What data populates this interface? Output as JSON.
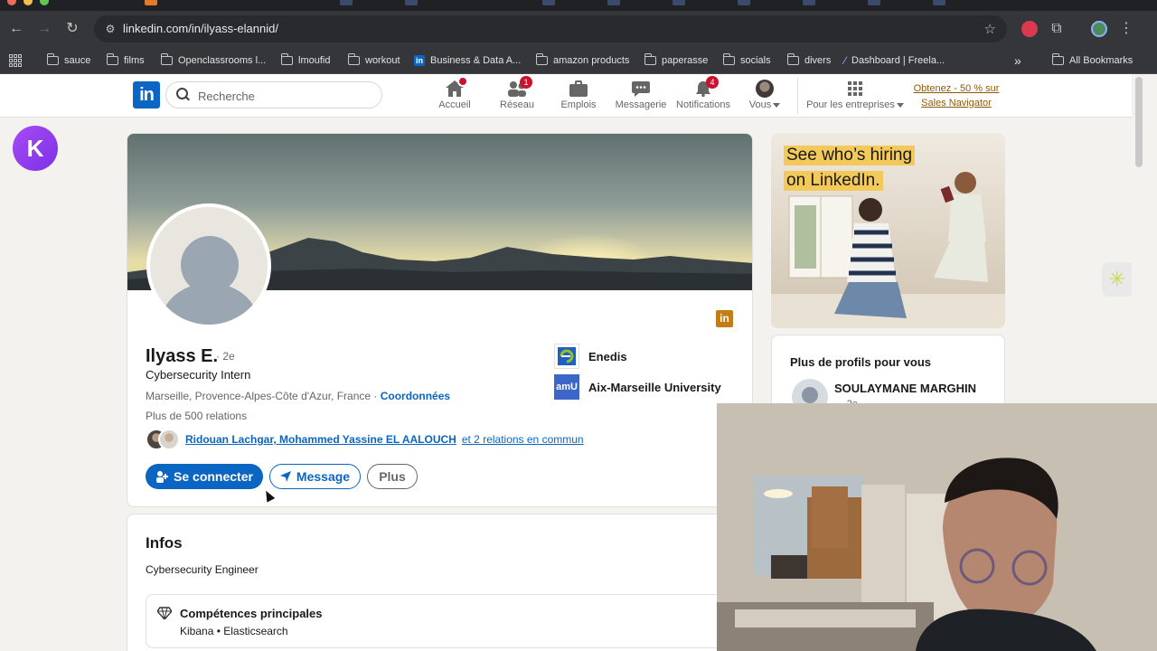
{
  "browser": {
    "url": "linkedin.com/in/ilyass-elannid/",
    "bookmarks": [
      {
        "label": "sauce",
        "icon": "folder-icon"
      },
      {
        "label": "films",
        "icon": "folder-icon"
      },
      {
        "label": "Openclassrooms l...",
        "icon": "folder-icon"
      },
      {
        "label": "lmoufid",
        "icon": "folder-icon"
      },
      {
        "label": "workout",
        "icon": "folder-icon"
      },
      {
        "label": "Business & Data A...",
        "icon": "linkedin-icon"
      },
      {
        "label": "amazon products",
        "icon": "folder-icon"
      },
      {
        "label": "paperasse",
        "icon": "folder-icon"
      },
      {
        "label": "socials",
        "icon": "folder-icon"
      },
      {
        "label": "divers",
        "icon": "folder-icon"
      },
      {
        "label": "Dashboard | Freela...",
        "icon": "site-icon"
      }
    ],
    "overflow": "»",
    "all_bookmarks": "All Bookmarks"
  },
  "header": {
    "search_placeholder": "Recherche",
    "nav": [
      {
        "label": "Accueil",
        "badge": "",
        "badge_dot": true
      },
      {
        "label": "Réseau",
        "badge": "1"
      },
      {
        "label": "Emplois",
        "badge": ""
      },
      {
        "label": "Messagerie",
        "badge": ""
      },
      {
        "label": "Notifications",
        "badge": "4"
      },
      {
        "label": "Vous",
        "badge": ""
      },
      {
        "label": "Pour les entreprises",
        "badge": ""
      }
    ],
    "premium_line1": "Obtenez - 50 % sur",
    "premium_line2": "Sales Navigator"
  },
  "profile": {
    "name": "Ilyass E.",
    "degree": "· 2e",
    "headline": "Cybersecurity Intern",
    "location": "Marseille, Provence-Alpes-Côte d'Azur, France · ",
    "contact_link": "Coordonnées",
    "connections": "Plus de 500 relations",
    "mutual_names": "Ridouan Lachgar, Mohammed Yassine EL AALOUCH",
    "mutual_rest": " et 2 relations en commun",
    "buttons": {
      "connect": "Se connecter",
      "message": "Message",
      "more": "Plus"
    },
    "companies": [
      {
        "name": "Enedis",
        "logo_text": "",
        "color": "#1f5fbf"
      },
      {
        "name": "Aix-Marseille University",
        "logo_text": "amU",
        "color": "#3c67c9"
      }
    ]
  },
  "infos": {
    "title": "Infos",
    "text": "Cybersecurity Engineer",
    "skills_title": "Compétences principales",
    "skills_value": "Kibana • Elasticsearch"
  },
  "sidebar": {
    "ad_line1": "See who’s hiring",
    "ad_line2": "on LinkedIn.",
    "pymk_title": "Plus de profils pour vous",
    "pymk_name": "SOULAYMANE MARGHIN",
    "pymk_degree": "· 2e"
  },
  "colors": {
    "linkedin_blue": "#0a66c2",
    "badge_red": "#cb112d",
    "premium_gold": "#915907",
    "ad_highlight": "#f3c95a"
  }
}
